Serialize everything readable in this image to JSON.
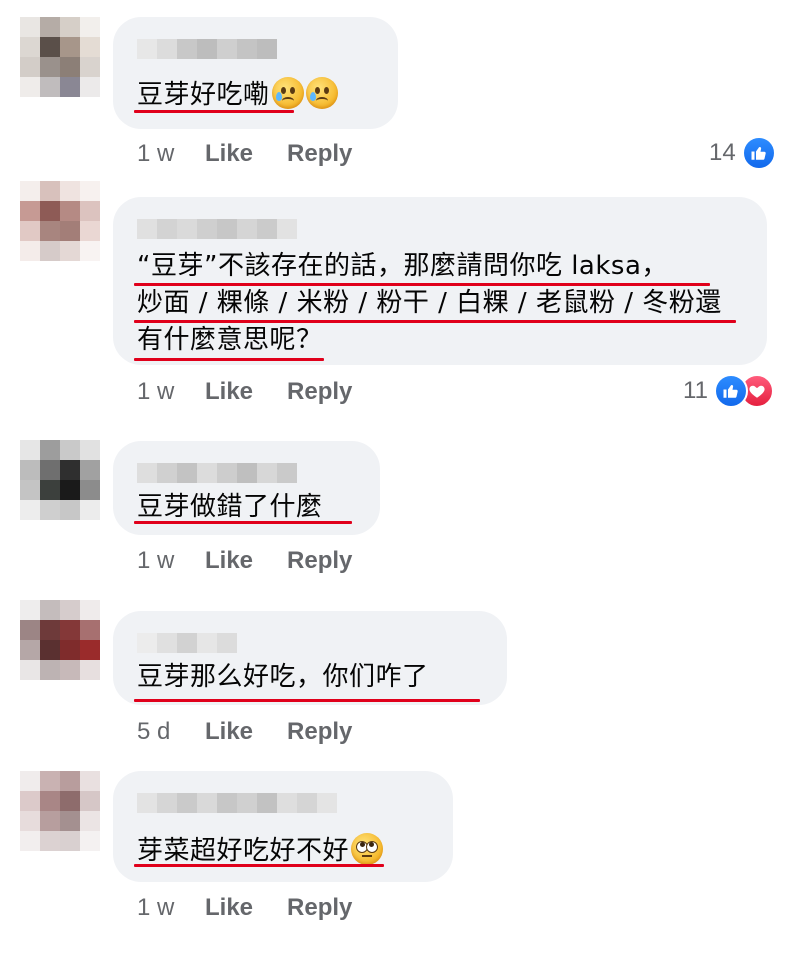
{
  "comments": [
    {
      "text_lines": [
        "豆芽好吃嘞"
      ],
      "emojis": [
        "crying-face-icon",
        "crying-face-icon"
      ],
      "time": "1 w",
      "like_label": "Like",
      "reply_label": "Reply",
      "reaction_count": "14",
      "reactions": [
        "like"
      ]
    },
    {
      "text_lines": [
        "“豆芽”不該存在的話，那麼請問你吃 laksa，",
        "炒面 / 粿條 / 米粉 / 粉干 / 白粿 / 老鼠粉 / 冬粉還",
        "有什麼意思呢？"
      ],
      "time": "1 w",
      "like_label": "Like",
      "reply_label": "Reply",
      "reaction_count": "11",
      "reactions": [
        "like",
        "love"
      ]
    },
    {
      "text_lines": [
        "豆芽做錯了什麼"
      ],
      "time": "1 w",
      "like_label": "Like",
      "reply_label": "Reply"
    },
    {
      "text_lines": [
        "豆芽那么好吃，你们咋了"
      ],
      "time": "5 d",
      "like_label": "Like",
      "reply_label": "Reply"
    },
    {
      "text_lines": [
        "芽菜超好吃好不好"
      ],
      "emojis": [
        "face-with-rolling-eyes-icon"
      ],
      "time": "1 w",
      "like_label": "Like",
      "reply_label": "Reply"
    }
  ],
  "colors": {
    "bubble_bg": "#f0f2f5",
    "meta_text": "#65676b",
    "underline": "#e0001b",
    "like_blue": "#1877f2",
    "love_red": "#f33e58"
  }
}
